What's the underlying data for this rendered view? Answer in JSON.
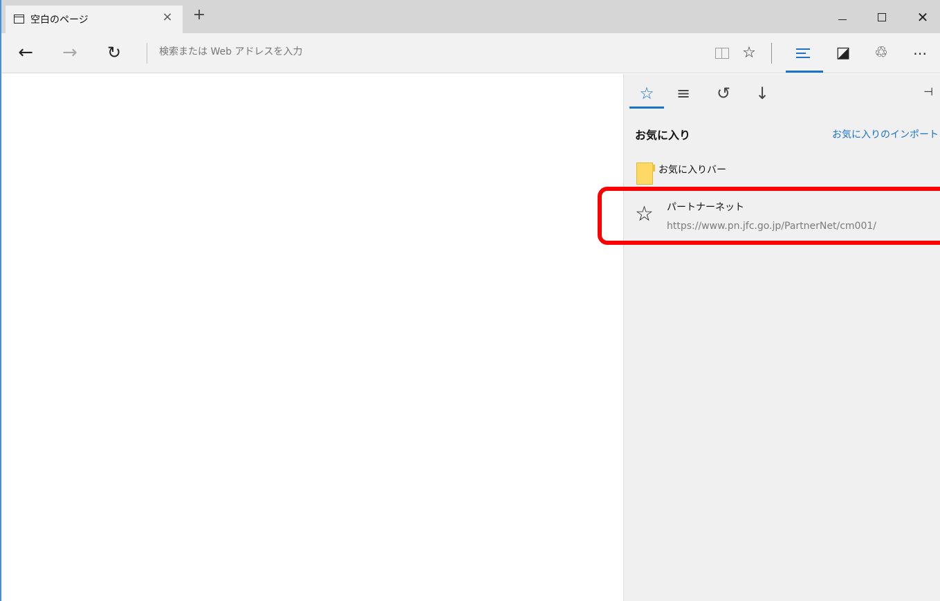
{
  "tab": {
    "icon": "page-icon",
    "title": "空白のページ",
    "close_glyph": "×",
    "new_tab_glyph": "+"
  },
  "window_controls": {
    "minimize": "minimize-icon",
    "maximize": "maximize-icon",
    "close_glyph": "✕"
  },
  "toolbar": {
    "back_glyph": "←",
    "forward_glyph": "→",
    "refresh_glyph": "↻",
    "address_placeholder": "検索または Web アドレスを入力",
    "fav_glyph": "☆",
    "note_glyph": "◪",
    "share_glyph": "♲",
    "more_glyph": "⋯"
  },
  "hub": {
    "tabs": {
      "favorites_glyph": "☆",
      "reading_list_glyph": "≡",
      "history_glyph": "↺",
      "downloads_glyph": "↓"
    },
    "pin_glyph": "⊣",
    "title": "お気に入り",
    "import_link": "お気に入りのインポート",
    "folder": {
      "label": "お気に入りバー",
      "color": "#ffd966"
    },
    "items": [
      {
        "name": "パートナーネット",
        "url": "https://www.pn.jfc.go.jp/PartnerNet/cm001/"
      }
    ]
  },
  "colors": {
    "accent": "#1a73c9",
    "highlight": "#ff0000"
  }
}
